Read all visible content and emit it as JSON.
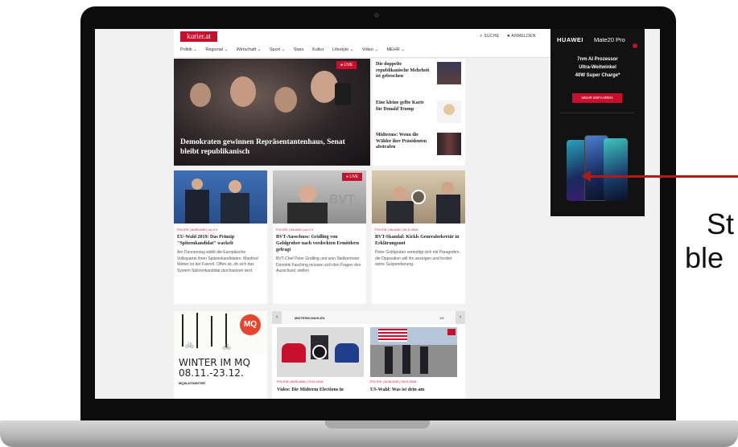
{
  "site": {
    "logo": "kurier.at",
    "search_label": "SUCHE",
    "login_label": "ANMELDEN",
    "nav": [
      "Politik ⌄",
      "Regional ⌄",
      "Wirtschaft ⌄",
      "Sport ⌄",
      "Stars",
      "Kultur",
      "Lifestyle ⌄",
      "Video ⌄",
      "MEHR ⌄"
    ],
    "live_label": "LIVE",
    "hero_title": "Demokraten gewinnen Repräsentantenhaus, Senat bleibt republikanisch",
    "side_items": [
      "Die doppelte republikanische Mehrheit ist gebrochen",
      "Eine kleine gelbe Karte für Donald Trump",
      "Midterms: Wenn die Wähler ihre Präsidenten abstrafen"
    ],
    "cards": [
      {
        "meta": "POLITIK | AUSLAND | vor 4 h",
        "title": "EU-Wahl 2019: Das Prinzip \"Spitzenkandidat\" wackelt",
        "body": "Am Donnerstag wählt die Europäische Volkspartei ihren Spitzenkandidaten. Manfred Weber ist der Favorit. Offen ist, ob sich das System Spitzenkandidat durchsetzen wird."
      },
      {
        "meta": "POLITIK | INLAND | vor 2 h",
        "title": "BVT-Ausschuss: Gridling von Goldgruber nach verdeckten Ermittlern gefragt",
        "body": "BVT-Chef Peter Gridling und sein Stellvertreter Dominik Fasching müssen sich den Fragen des Ausschuss' stellen."
      },
      {
        "meta": "POLITIK | INLAND | 06.11.2018",
        "title": "BVT-Skandal: Kickls Generalsekretär in Erklärungsnot",
        "body": "Peter Goldgruber verteidigt sich mit Paragrafen, die Opposition will ihn anzeigen und fordert seine Suspendierung."
      }
    ],
    "mq": {
      "badge": "MQ",
      "title": "WINTER IM MQ",
      "dates": "08.11.-23.12.",
      "url": "MQW.AT/WINTER"
    },
    "video_box": {
      "label": "MIDTERM-WAHLEN",
      "counter": "1/6",
      "items": [
        {
          "meta": "POLITIK | AUSLAND | 03.11.2018",
          "title": "Video: Die Midterm Elections in"
        },
        {
          "meta": "POLITIK | AUSLAND | 05.11.2018",
          "title": "US-Wahl: Was ist drin am"
        }
      ]
    }
  },
  "ad": {
    "brand": "HUAWEI",
    "model": "Mate20 Pro",
    "lines": [
      "7nm AI Prozessor",
      "Ultra-Weitwinkel",
      "40W Super Charge*"
    ],
    "cta": "MEHR ERFAHREN"
  },
  "annotation": {
    "line1": "St",
    "line2": "ble"
  },
  "colors": {
    "brand": "#c8102e",
    "arrow": "#b11a12"
  }
}
